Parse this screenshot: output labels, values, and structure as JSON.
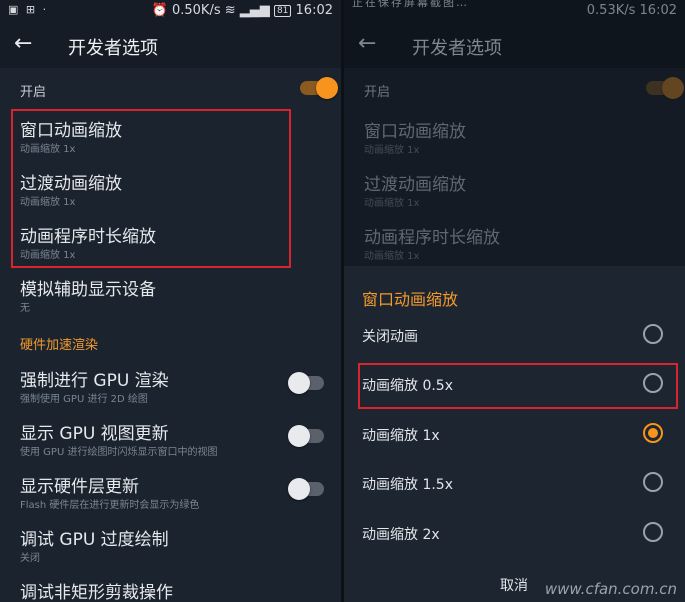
{
  "left": {
    "status": {
      "left_icons": "▣ ⊞ ·",
      "alarm_icon": "⏰",
      "net_speed": "0.50K/s",
      "battery": "81",
      "time": "16:02"
    },
    "title": "开发者选项",
    "toggle_label": "开启",
    "items": [
      {
        "title": "窗口动画缩放",
        "sub": "动画缩放 1x"
      },
      {
        "title": "过渡动画缩放",
        "sub": "动画缩放 1x"
      },
      {
        "title": "动画程序时长缩放",
        "sub": "动画缩放 1x"
      },
      {
        "title": "模拟辅助显示设备",
        "sub": "无"
      }
    ],
    "section": "硬件加速渲染",
    "hw_items": [
      {
        "title": "强制进行 GPU 渲染",
        "sub": "强制使用 GPU 进行 2D 绘图"
      },
      {
        "title": "显示 GPU 视图更新",
        "sub": "使用 GPU 进行绘图时闪烁显示窗口中的视图"
      },
      {
        "title": "显示硬件层更新",
        "sub": "Flash 硬件层在进行更新时会显示为绿色"
      },
      {
        "title": "调试 GPU 过度绘制",
        "sub": "关闭"
      },
      {
        "title": "调试非矩形剪裁操作",
        "sub": ""
      }
    ]
  },
  "right": {
    "status": {
      "top_text": "正在保存屏幕截图…",
      "net_speed": "0.53K/s",
      "time": "16:02"
    },
    "title": "开发者选项",
    "toggle_label": "开启",
    "items": [
      {
        "title": "窗口动画缩放",
        "sub": "动画缩放 1x"
      },
      {
        "title": "过渡动画缩放",
        "sub": "动画缩放 1x"
      },
      {
        "title": "动画程序时长缩放",
        "sub": "动画缩放 1x"
      }
    ],
    "dialog": {
      "title": "窗口动画缩放",
      "options": [
        "关闭动画",
        "动画缩放 0.5x",
        "动画缩放 1x",
        "动画缩放 1.5x",
        "动画缩放 2x"
      ],
      "selected": "动画缩放 1x",
      "cancel": "取消"
    },
    "watermark": "www.cfan.com.cn"
  },
  "colors": {
    "accent": "#f7941d",
    "highlight_box": "#d9242b"
  }
}
